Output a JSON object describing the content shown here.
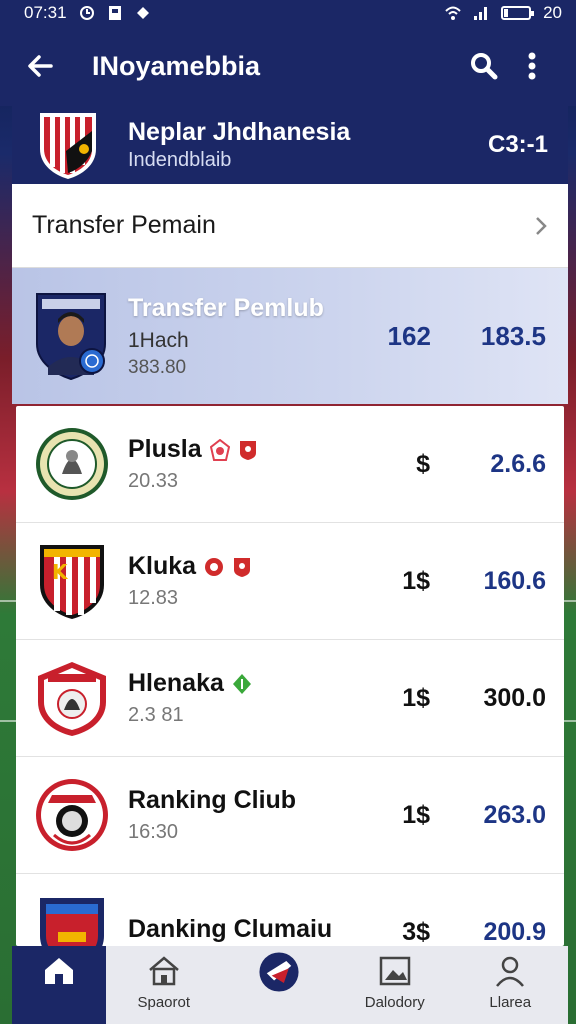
{
  "status_bar": {
    "time": "07:31",
    "battery": "20"
  },
  "app_bar": {
    "title": "INoyamebbia"
  },
  "league": {
    "name": "Neplar Jhdhanesia",
    "subtitle": "Indendblaib",
    "score": "C3:-1"
  },
  "transfer_row": {
    "label": "Transfer Pemain"
  },
  "player_card": {
    "title": "Transfer Pemlub",
    "sub": "1Hach",
    "sub2": "383.80",
    "value1": "162",
    "value2": "183.5"
  },
  "clubs": [
    {
      "name": "Plusla",
      "date": "20.33",
      "currency": "$",
      "value": "2.6.6",
      "tag_colors": [
        "#e04050",
        "#d02b2b"
      ]
    },
    {
      "name": "Kluka",
      "date": "12.83",
      "currency": "1$",
      "value": "160.6",
      "tag_colors": [
        "#d02b2b",
        "#d02b2b"
      ]
    },
    {
      "name": "Hlenaka",
      "date": "2.3 81",
      "currency": "1$",
      "value": "300.0",
      "tag_colors": [
        "#3aa83a"
      ]
    },
    {
      "name": "Ranking Cliub",
      "date": "16:30",
      "currency": "1$",
      "value": "263.0",
      "tag_colors": []
    },
    {
      "name": "Danking Clumaiu",
      "date": "",
      "currency": "3$",
      "value": "200.9",
      "tag_colors": []
    }
  ],
  "bottom_nav": [
    {
      "label": "",
      "icon": "home-icon",
      "active": true
    },
    {
      "label": "Spaorot",
      "icon": "house-icon",
      "active": false
    },
    {
      "label": "",
      "icon": "club-logo-icon",
      "active": false
    },
    {
      "label": "Dalodory",
      "icon": "image-icon",
      "active": false
    },
    {
      "label": "Llarea",
      "icon": "person-icon",
      "active": false
    }
  ],
  "colors": {
    "primary": "#1b2766",
    "accent_value": "#1d3585",
    "highlight": "#cdd5ee"
  }
}
